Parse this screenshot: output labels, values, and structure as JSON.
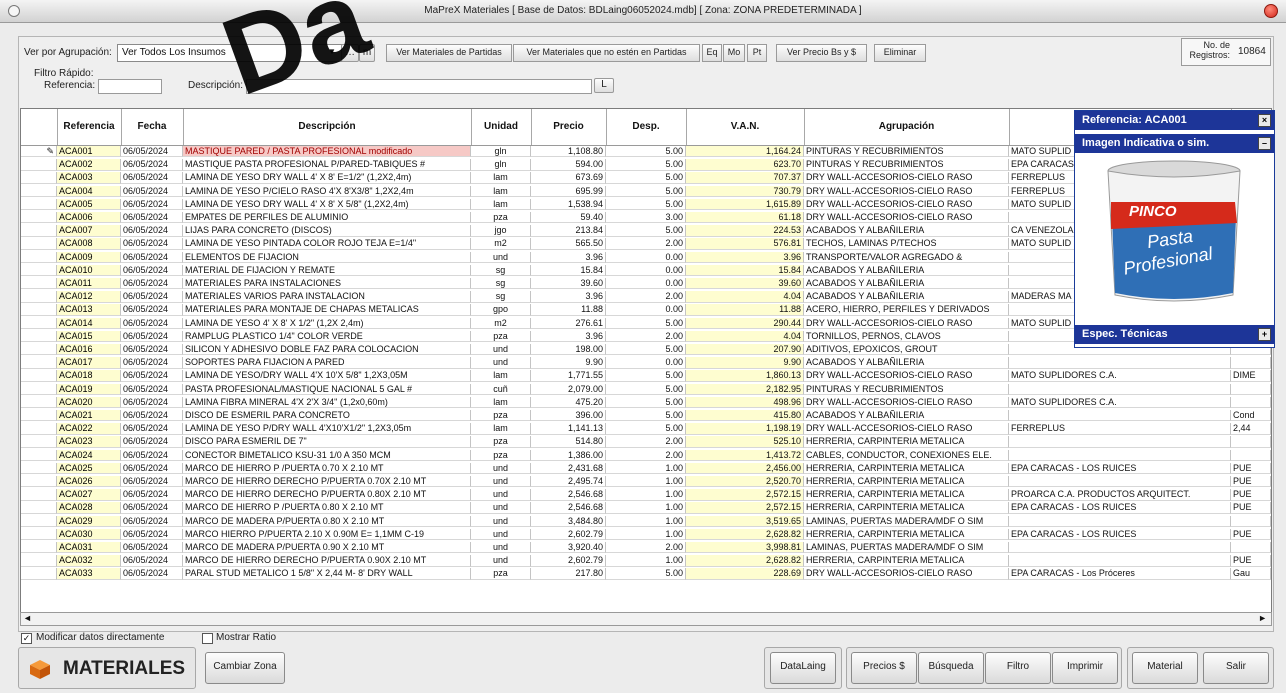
{
  "window": {
    "title": "MaPreX Materiales   [ Base de Datos: BDLaing06052024.mdb] [ Zona: ZONA PREDETERMINADA ]"
  },
  "toolbar": {
    "agrupacion_label": "Ver por Agrupación:",
    "agrupacion_value": "Ver Todos Los Insumos",
    "m_btn": "m",
    "btn_partidas": "Ver Materiales de Partidas",
    "btn_no_partidas": "Ver Materiales que no estén en Partidas",
    "btn_eq": "Eq",
    "btn_mo": "Mo",
    "btn_pt": "Pt",
    "btn_precio": "Ver Precio Bs y $",
    "btn_eliminar": "Eliminar",
    "registros_label": "No. de Registros:",
    "registros_value": "10864"
  },
  "filtro": {
    "title": "Filtro Rápido:",
    "referencia_label": "Referencia:",
    "descripcion_label": "Descripción:",
    "btn_l": "L"
  },
  "watermark": "Da",
  "table": {
    "columns": [
      "",
      "Referencia",
      "Fecha",
      "Descripción",
      "Unidad",
      "Precio",
      "Desp.",
      "V.A.N.",
      "Agrupación",
      "",
      ""
    ],
    "rows": [
      [
        "ACA001",
        "06/05/2024",
        "MASTIQUE PARED / PASTA PROFESIONAL modificado",
        "gln",
        "1,108.80",
        "5.00",
        "1,164.24",
        "PINTURAS Y RECUBRIMIENTOS",
        "MATO SUPLID",
        ""
      ],
      [
        "ACA002",
        "06/05/2024",
        "MASTIQUE PASTA PROFESIONAL P/PARED-TABIQUES #",
        "gln",
        "594.00",
        "5.00",
        "623.70",
        "PINTURAS Y RECUBRIMIENTOS",
        "EPA CARACAS",
        ""
      ],
      [
        "ACA003",
        "06/05/2024",
        "LAMINA DE YESO DRY WALL 4' X 8' E=1/2\" (1,2X2,4m)",
        "lam",
        "673.69",
        "5.00",
        "707.37",
        "DRY WALL-ACCESORIOS-CIELO RASO",
        "FERREPLUS",
        ""
      ],
      [
        "ACA004",
        "06/05/2024",
        "LAMINA DE YESO P/CIELO RASO 4'X 8'X3/8\" 1,2X2,4m",
        "lam",
        "695.99",
        "5.00",
        "730.79",
        "DRY WALL-ACCESORIOS-CIELO RASO",
        "FERREPLUS",
        ""
      ],
      [
        "ACA005",
        "06/05/2024",
        "LAMINA DE YESO DRY WALL 4' X 8' X 5/8\" (1,2X2,4m)",
        "lam",
        "1,538.94",
        "5.00",
        "1,615.89",
        "DRY WALL-ACCESORIOS-CIELO RASO",
        "MATO SUPLID",
        ""
      ],
      [
        "ACA006",
        "06/05/2024",
        "EMPATES DE PERFILES DE ALUMINIO",
        "pza",
        "59.40",
        "3.00",
        "61.18",
        "DRY WALL-ACCESORIOS-CIELO RASO",
        "",
        ""
      ],
      [
        "ACA007",
        "06/05/2024",
        "LIJAS PARA CONCRETO (DISCOS)",
        "jgo",
        "213.84",
        "5.00",
        "224.53",
        "ACABADOS Y ALBAÑILERIA",
        "CA VENEZOLA",
        ""
      ],
      [
        "ACA008",
        "06/05/2024",
        "LAMINA DE YESO PINTADA COLOR ROJO TEJA E=1/4\"",
        "m2",
        "565.50",
        "2.00",
        "576.81",
        "TECHOS, LAMINAS P/TECHOS",
        "MATO SUPLID",
        ""
      ],
      [
        "ACA009",
        "06/05/2024",
        "ELEMENTOS DE FIJACION",
        "und",
        "3.96",
        "0.00",
        "3.96",
        "TRANSPORTE/VALOR AGREGADO &",
        "",
        ""
      ],
      [
        "ACA010",
        "06/05/2024",
        "MATERIAL DE FIJACION Y REMATE",
        "sg",
        "15.84",
        "0.00",
        "15.84",
        "ACABADOS Y ALBAÑILERIA",
        "",
        ""
      ],
      [
        "ACA011",
        "06/05/2024",
        "MATERIALES PARA INSTALACIONES",
        "sg",
        "39.60",
        "0.00",
        "39.60",
        "ACABADOS Y ALBAÑILERIA",
        "",
        ""
      ],
      [
        "ACA012",
        "06/05/2024",
        "MATERIALES VARIOS PARA INSTALACION",
        "sg",
        "3.96",
        "2.00",
        "4.04",
        "ACABADOS Y ALBAÑILERIA",
        "MADERAS MA",
        ""
      ],
      [
        "ACA013",
        "06/05/2024",
        "MATERIALES PARA MONTAJE DE CHAPAS METALICAS",
        "gpo",
        "11.88",
        "0.00",
        "11.88",
        "ACERO, HIERRO, PERFILES Y DERIVADOS",
        "",
        ""
      ],
      [
        "ACA014",
        "06/05/2024",
        "LAMINA DE YESO 4' X 8' X 1/2\" (1,2X 2,4m)",
        "m2",
        "276.61",
        "5.00",
        "290.44",
        "DRY WALL-ACCESORIOS-CIELO RASO",
        "MATO SUPLID",
        ""
      ],
      [
        "ACA015",
        "06/05/2024",
        "RAMPLUG PLASTICO 1/4\" COLOR VERDE",
        "pza",
        "3.96",
        "2.00",
        "4.04",
        "TORNILLOS, PERNOS, CLAVOS",
        "",
        ""
      ],
      [
        "ACA016",
        "06/05/2024",
        "SILICON Y ADHESIVO DOBLE FAZ PARA COLOCACION",
        "und",
        "198.00",
        "5.00",
        "207.90",
        "ADITIVOS, EPOXICOS, GROUT",
        "",
        ""
      ],
      [
        "ACA017",
        "06/05/2024",
        "SOPORTES PARA FIJACION A PARED",
        "und",
        "9.90",
        "0.00",
        "9.90",
        "ACABADOS Y ALBAÑILERIA",
        "",
        ""
      ],
      [
        "ACA018",
        "06/05/2024",
        "LAMINA DE YESO/DRY WALL 4'X 10'X 5/8\" 1,2X3,05M",
        "lam",
        "1,771.55",
        "5.00",
        "1,860.13",
        "DRY WALL-ACCESORIOS-CIELO RASO",
        "MATO SUPLIDORES C.A.",
        "DIME"
      ],
      [
        "ACA019",
        "06/05/2024",
        "PASTA PROFESIONAL/MASTIQUE NACIONAL 5 GAL #",
        "cuñ",
        "2,079.00",
        "5.00",
        "2,182.95",
        "PINTURAS Y RECUBRIMIENTOS",
        "",
        ""
      ],
      [
        "ACA020",
        "06/05/2024",
        "LAMINA FIBRA MINERAL 4'X 2'X 3/4\" (1,2x0,60m)",
        "lam",
        "475.20",
        "5.00",
        "498.96",
        "DRY WALL-ACCESORIOS-CIELO RASO",
        "MATO SUPLIDORES C.A.",
        ""
      ],
      [
        "ACA021",
        "06/05/2024",
        "DISCO DE ESMERIL PARA CONCRETO",
        "pza",
        "396.00",
        "5.00",
        "415.80",
        "ACABADOS Y ALBAÑILERIA",
        "",
        "Cond"
      ],
      [
        "ACA022",
        "06/05/2024",
        "LAMINA DE YESO P/DRY WALL 4'X10'X1/2\" 1,2X3,05m",
        "lam",
        "1,141.13",
        "5.00",
        "1,198.19",
        "DRY WALL-ACCESORIOS-CIELO RASO",
        "FERREPLUS",
        "2,44"
      ],
      [
        "ACA023",
        "06/05/2024",
        "DISCO PARA ESMERIL DE 7\"",
        "pza",
        "514.80",
        "2.00",
        "525.10",
        "HERRERIA, CARPINTERIA METALICA",
        "",
        ""
      ],
      [
        "ACA024",
        "06/05/2024",
        "CONECTOR BIMETALICO KSU-31 1/0 A 350 MCM",
        "pza",
        "1,386.00",
        "2.00",
        "1,413.72",
        "CABLES, CONDUCTOR, CONEXIONES ELE.",
        "",
        ""
      ],
      [
        "ACA025",
        "06/05/2024",
        "MARCO DE HIERRO P /PUERTA 0.70 X 2.10 MT",
        "und",
        "2,431.68",
        "1.00",
        "2,456.00",
        "HERRERIA, CARPINTERIA METALICA",
        "EPA CARACAS - LOS RUICES",
        "PUE"
      ],
      [
        "ACA026",
        "06/05/2024",
        "MARCO DE HIERRO DERECHO P/PUERTA 0.70X 2.10 MT",
        "und",
        "2,495.74",
        "1.00",
        "2,520.70",
        "HERRERIA, CARPINTERIA METALICA",
        "",
        "PUE"
      ],
      [
        "ACA027",
        "06/05/2024",
        "MARCO DE HIERRO DERECHO P/PUERTA 0.80X 2.10 MT",
        "und",
        "2,546.68",
        "1.00",
        "2,572.15",
        "HERRERIA, CARPINTERIA METALICA",
        "PROARCA C.A. PRODUCTOS ARQUITECT.",
        "PUE"
      ],
      [
        "ACA028",
        "06/05/2024",
        "MARCO DE HIERRO P /PUERTA 0.80 X 2.10 MT",
        "und",
        "2,546.68",
        "1.00",
        "2,572.15",
        "HERRERIA, CARPINTERIA METALICA",
        "EPA CARACAS - LOS RUICES",
        "PUE"
      ],
      [
        "ACA029",
        "06/05/2024",
        "MARCO DE MADERA P/PUERTA 0.80 X 2.10 MT",
        "und",
        "3,484.80",
        "1.00",
        "3,519.65",
        "LAMINAS, PUERTAS MADERA/MDF O SIM",
        "",
        ""
      ],
      [
        "ACA030",
        "06/05/2024",
        "MARCO HIERRO P/PUERTA 2.10 X 0.90M E= 1,1MM C-19",
        "und",
        "2,602.79",
        "1.00",
        "2,628.82",
        "HERRERIA, CARPINTERIA METALICA",
        "EPA CARACAS - LOS RUICES",
        "PUE"
      ],
      [
        "ACA031",
        "06/05/2024",
        "MARCO DE MADERA P/PUERTA 0.90 X 2.10 MT",
        "und",
        "3,920.40",
        "2.00",
        "3,998.81",
        "LAMINAS, PUERTAS MADERA/MDF O SIM",
        "",
        ""
      ],
      [
        "ACA032",
        "06/05/2024",
        "MARCO DE HIERRO DERECHO P/PUERTA 0.90X 2.10 MT",
        "und",
        "2,602.79",
        "1.00",
        "2,628.82",
        "HERRERIA, CARPINTERIA METALICA",
        "",
        "PUE"
      ],
      [
        "ACA033",
        "06/05/2024",
        "PARAL STUD METALICO 1 5/8\" X 2,44 M- 8' DRY WALL",
        "pza",
        "217.80",
        "5.00",
        "228.69",
        "DRY WALL-ACCESORIOS-CIELO RASO",
        "EPA CARACAS - Los Próceres",
        "Gau"
      ]
    ]
  },
  "floatpanel": {
    "referencia": "Referencia: ACA001",
    "imagen": "Imagen Indicativa o sim.",
    "espec": "Espec. Técnicas",
    "product_brand": "PINCO",
    "product_name_1": "Pasta",
    "product_name_2": "Profesional"
  },
  "options": {
    "modificar": "Modificar datos directamente",
    "mostrar_ratio": "Mostrar Ratio"
  },
  "bottom": {
    "brand": "MATERIALES",
    "cambiar_zona": "Cambiar Zona",
    "datalaing": "DataLaing",
    "precios": "Precios $",
    "busqueda": "Búsqueda",
    "filtro": "Filtro",
    "imprimir": "Imprimir",
    "material": "Material",
    "salir": "Salir"
  }
}
